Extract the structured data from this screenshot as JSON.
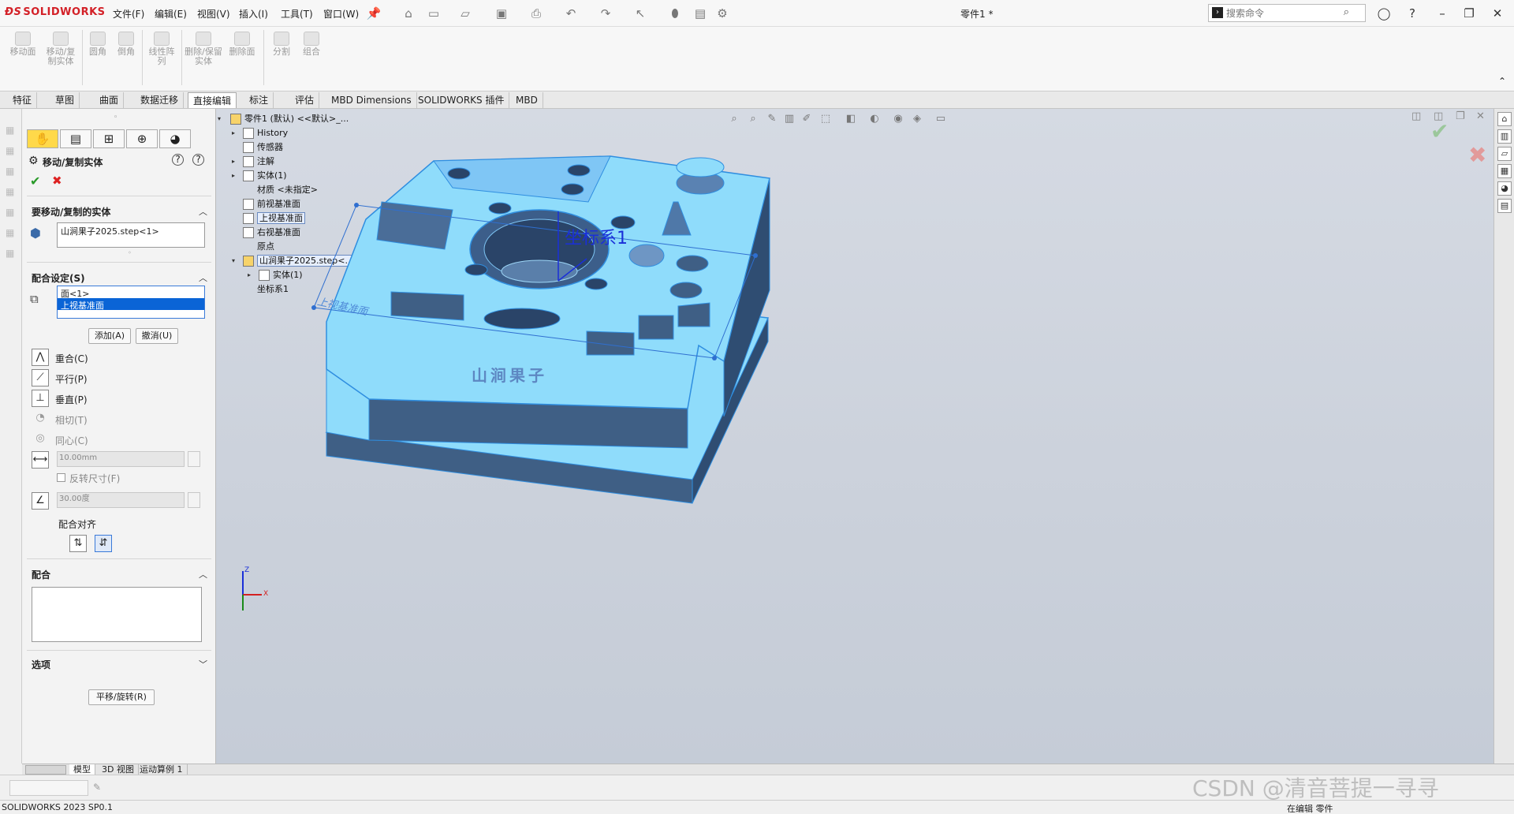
{
  "app": {
    "logo_text": "SOLIDWORKS",
    "doc_title": "零件1 *",
    "menus": [
      "文件(F)",
      "编辑(E)",
      "视图(V)",
      "插入(I)",
      "工具(T)",
      "窗口(W)"
    ],
    "search_placeholder": "搜索命令"
  },
  "ribbon": {
    "buttons": [
      "移动面",
      "移动/复制实体",
      "圆角",
      "倒角",
      "线性阵列",
      "删除/保留实体",
      "删除面",
      "分割",
      "组合"
    ]
  },
  "command_tabs": [
    "特征",
    "草图",
    "曲面",
    "数据迁移",
    "直接编辑",
    "标注",
    "评估",
    "MBD Dimensions",
    "SOLIDWORKS 插件",
    "MBD"
  ],
  "command_tab_active": "直接编辑",
  "pm": {
    "title": "移动/复制实体",
    "section_bodies": "要移动/复制的实体",
    "body_item": "山涧果子2025.step<1>",
    "section_mate": "配合设定(S)",
    "mate_items": [
      "面<1>",
      "上视基准面"
    ],
    "add_button": "添加(A)",
    "undo_button": "撤消(U)",
    "mate_types": [
      "重合(C)",
      "平行(P)",
      "垂直(P)",
      "相切(T)",
      "同心(C)"
    ],
    "distance_value": "10.00mm",
    "flip_dimension": "反转尺寸(F)",
    "angle_value": "30.00度",
    "mate_alignment": "配合对齐",
    "section_mates": "配合",
    "section_options": "选项",
    "translate_rotate_button": "平移/旋转(R)"
  },
  "tree": {
    "root": "零件1 (默认) <<默认>_...",
    "items": [
      "History",
      "传感器",
      "注解",
      "实体(1)",
      "材质 <未指定>",
      "前视基准面",
      "上视基准面",
      "右视基准面",
      "原点",
      "山涧果子2025.step<...",
      "实体(1)",
      "坐标系1"
    ]
  },
  "model": {
    "coord_label": "坐标系1",
    "plane_label": "上视基准面",
    "engraving": "山涧果子",
    "triad_z": "Z",
    "triad_x": "X",
    "colors": {
      "top": "#8fdcfb",
      "side": "#3f5f85",
      "edge": "#2f8ee0",
      "selected": "#7fc6f5"
    }
  },
  "bottom_tabs": [
    "模型",
    "3D 视图",
    "运动算例 1"
  ],
  "status": {
    "version": "SOLIDWORKS 2023 SP0.1",
    "editing": "在编辑 零件"
  },
  "watermark": "CSDN @清音菩提一寻寻"
}
